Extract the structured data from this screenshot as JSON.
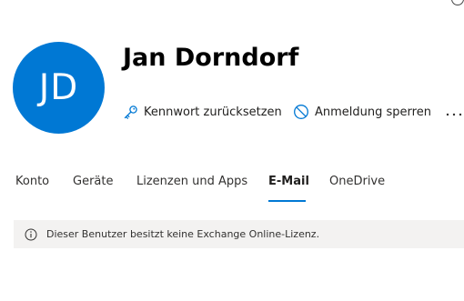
{
  "user": {
    "initials": "JD",
    "display_name": "Jan Dorndorf",
    "avatar_color": "#0078d4"
  },
  "actions": {
    "reset_password": {
      "label": "Kennwort zurücksetzen",
      "icon": "key-icon"
    },
    "block_sign_in": {
      "label": "Anmeldung sperren",
      "icon": "block-icon"
    },
    "more": {
      "icon": "more-ellipsis-icon"
    }
  },
  "tabs": [
    {
      "label": "Konto",
      "active": false
    },
    {
      "label": "Geräte",
      "active": false
    },
    {
      "label": "Lizenzen und Apps",
      "active": false
    },
    {
      "label": "E-Mail",
      "active": true
    },
    {
      "label": "OneDrive",
      "active": false
    }
  ],
  "message_bar": {
    "icon": "info-icon",
    "text": "Dieser Benutzer besitzt keine Exchange Online-Lizenz."
  },
  "colors": {
    "accent": "#0078d4",
    "message_background": "#f3f2f1"
  }
}
